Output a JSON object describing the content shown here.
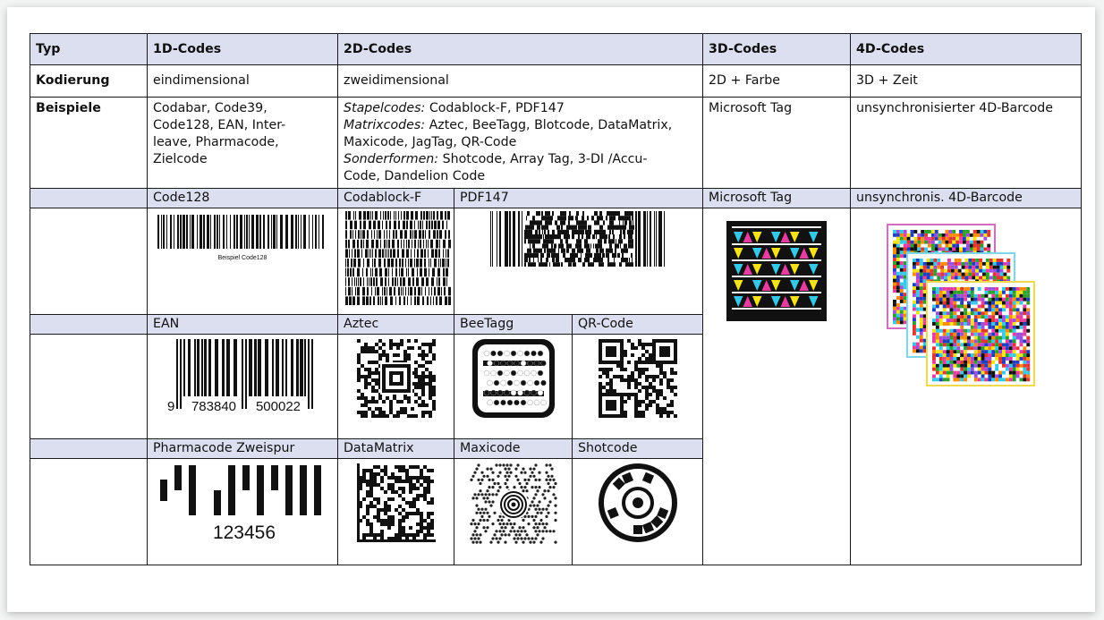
{
  "header": {
    "typ": "Typ",
    "c1d": "1D-Codes",
    "c2d": "2D-Codes",
    "c3d": "3D-Codes",
    "c4d": "4D-Codes"
  },
  "kodierung": {
    "label": "Kodierung",
    "c1d": "eindimensional",
    "c2d": "zweidimensional",
    "c3d": "2D + Farbe",
    "c4d": "3D + Zeit"
  },
  "beispiele": {
    "label": "Beispiele",
    "c1d_lines": [
      "Codabar, Code39,",
      "Code128, EAN, Inter-",
      "leave, Pharmacode,",
      "Zielcode"
    ],
    "c2d": {
      "stapel_label": "Stapelcodes:",
      "stapel_text": " Codablock-F, PDF147",
      "matrix_label": "Matrixcodes:",
      "matrix_text_1": " Aztec, BeeTagg, Blotcode, DataMatrix,",
      "matrix_text_2": "Maxicode, JagTag, QR-Code",
      "sonder_label": "Sonderformen:",
      "sonder_text_1": " Shotcode, Array Tag, 3-DI /Accu-",
      "sonder_text_2": "Code, Dandelion Code"
    },
    "c3d": "Microsoft Tag",
    "c4d": "unsynchronisierter 4D-Barcode"
  },
  "labels_row1": {
    "code128": "Code128",
    "codablock": "Codablock-F",
    "pdf147": "PDF147",
    "mstag": "Microsoft Tag",
    "unsync": "unsynchronis. 4D-Barcode"
  },
  "labels_row2": {
    "ean": "EAN",
    "aztec": "Aztec",
    "beetagg": "BeeTagg",
    "qr": "QR-Code"
  },
  "labels_row3": {
    "pharma": "Pharmacode Zweispur",
    "datamatrix": "DataMatrix",
    "maxicode": "Maxicode",
    "shotcode": "Shotcode"
  },
  "image_text": {
    "code128_caption": "Beispiel Code128",
    "ean_first": "9",
    "ean_left": "783840",
    "ean_right": "500022",
    "pharma_number": "123456"
  },
  "colors": {
    "header_bg": "#dcdff0",
    "cyan": "#36c8e8",
    "magenta": "#e83da0",
    "yellow": "#f5e21a"
  }
}
